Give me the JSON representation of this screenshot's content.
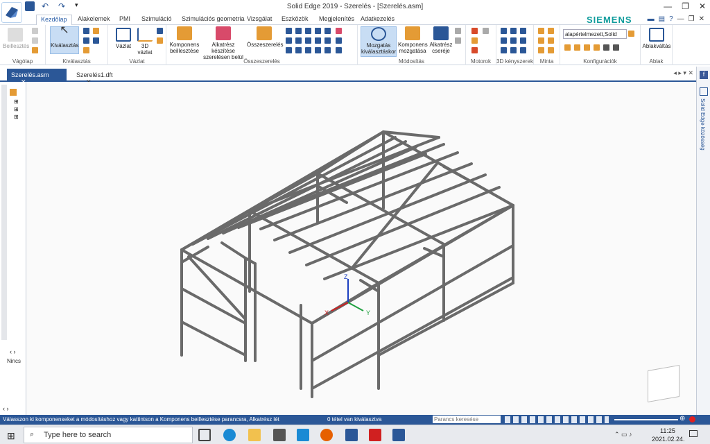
{
  "title": "Solid Edge 2019 - Szerelés - [Szerelés.asm]",
  "brand": "SIEMENS",
  "menu_tabs": [
    "Kezdőlap",
    "Alakelemek",
    "PMI",
    "Szimuláció",
    "Szimulációs geometria",
    "Vizsgálat",
    "Eszközök",
    "Megjelenítés",
    "Adatkezelés"
  ],
  "ribbon": {
    "beilleszt": "Beillesztés",
    "kivalasztas": "Kiválasztás",
    "vazlat": "Vázlat",
    "vazlat3d": "3D vázlat",
    "komponens": "Komponens beillesztése",
    "alkatresz": "Alkatrész készítése szerelésen belül",
    "osszeszereles": "Összeszerelés",
    "mozgatas": "Mozgatás kiválasztáskor",
    "komp_mozgatas": "Komponens mozgatása",
    "alk_csere": "Alkatrész cseréje",
    "config_select": "alapértelmezett,Solid",
    "ablakvaltas": "Ablakváltás",
    "groups": [
      "Vágólap",
      "Kiválasztás",
      "Vázlat",
      "Összeszerelés",
      "Módosítás",
      "Motorok",
      "3D kényszerek",
      "Minta",
      "Konfigurációk",
      "Ablak"
    ]
  },
  "doc_tabs": [
    "Szerelés.asm",
    "Szerelés1.dft"
  ],
  "left_panel": {
    "bottom_label": "Nincs"
  },
  "right_bar_label": "Solid Edge közösség",
  "status": {
    "prompt": "Válasszon ki komponenseket a módosításhoz vagy kattintson a Komponens beillesztése parancsra, Alkatrész lét",
    "selection": "0 tétel van kiválasztva",
    "command_search_placeholder": "Parancs keresése"
  },
  "axes": {
    "x": "X",
    "y": "Y",
    "z": "Z"
  },
  "taskbar": {
    "search": "Type here to search",
    "time": "11:25",
    "date": "2021.02.24."
  },
  "colors": {
    "accent": "#2b5797",
    "frame": "#6a6a6a",
    "siemens": "#109c9c"
  }
}
